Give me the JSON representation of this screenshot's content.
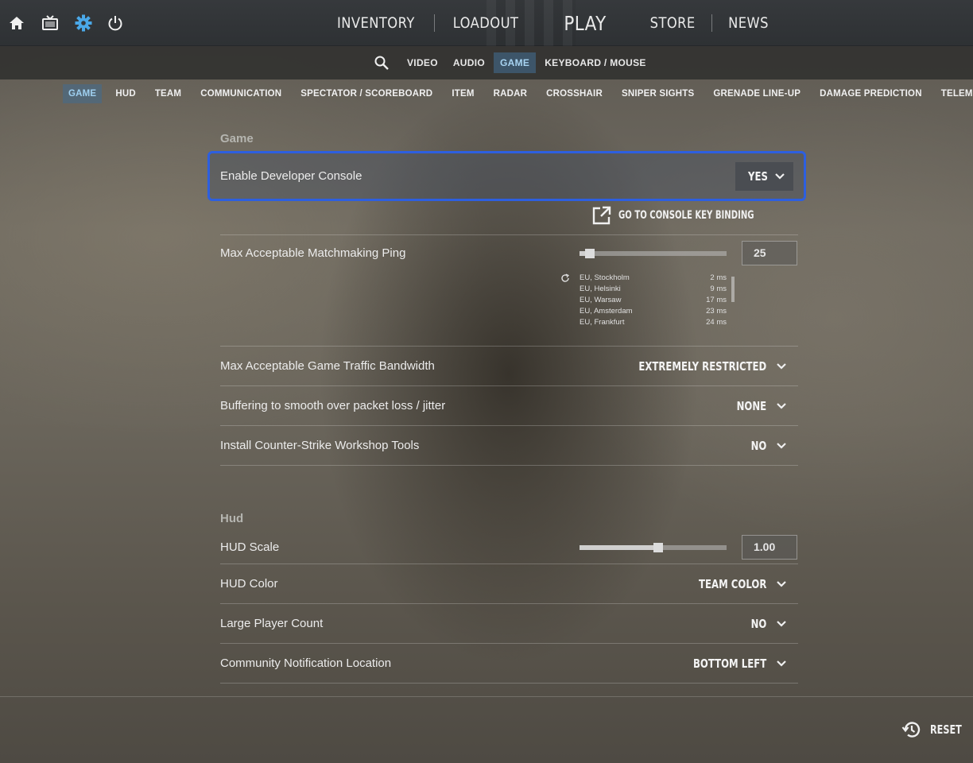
{
  "colors": {
    "focus_border": "#2d5fe0",
    "active_tab_text": "#a8d4f2",
    "settings_icon": "#4aa8e8"
  },
  "topbar": {
    "icons": [
      "home-icon",
      "tv-icon",
      "settings-gear-icon",
      "power-icon"
    ],
    "nav": {
      "inventory": "INVENTORY",
      "loadout": "LOADOUT",
      "play": "PLAY",
      "store": "STORE",
      "news": "NEWS"
    }
  },
  "subnav": {
    "search_icon": "search-icon",
    "items": {
      "video": "VIDEO",
      "audio": "AUDIO",
      "game": "GAME",
      "keyboard": "KEYBOARD / MOUSE"
    },
    "active": "GAME"
  },
  "categories": {
    "game": "GAME",
    "hud": "HUD",
    "team": "TEAM",
    "communication": "COMMUNICATION",
    "spectator": "SPECTATOR / SCOREBOARD",
    "item": "ITEM",
    "radar": "RADAR",
    "crosshair": "CROSSHAIR",
    "sniper": "SNIPER SIGHTS",
    "grenade": "GRENADE LINE-UP",
    "damage": "DAMAGE PREDICTION",
    "telemetry": "TELEMETRY",
    "active": "GAME"
  },
  "game_section": {
    "title": "Game",
    "dev_console": {
      "label": "Enable Developer Console",
      "value": "YES"
    },
    "console_link": "GO TO CONSOLE KEY BINDING",
    "ping": {
      "label": "Max Acceptable Matchmaking Ping",
      "value": "25",
      "slider_fraction": 0.04,
      "servers": [
        {
          "name": "EU, Stockholm",
          "ms": "2 ms"
        },
        {
          "name": "EU, Helsinki",
          "ms": "9 ms"
        },
        {
          "name": "EU, Warsaw",
          "ms": "17 ms"
        },
        {
          "name": "EU, Amsterdam",
          "ms": "23 ms"
        },
        {
          "name": "EU, Frankfurt",
          "ms": "24 ms"
        }
      ]
    },
    "bandwidth": {
      "label": "Max Acceptable Game Traffic Bandwidth",
      "value": "EXTREMELY RESTRICTED"
    },
    "buffering": {
      "label": "Buffering to smooth over packet loss / jitter",
      "value": "NONE"
    },
    "workshop": {
      "label": "Install Counter-Strike Workshop Tools",
      "value": "NO"
    }
  },
  "hud_section": {
    "title": "Hud",
    "scale": {
      "label": "HUD Scale",
      "value": "1.00",
      "slider_fraction": 0.5
    },
    "color": {
      "label": "HUD Color",
      "value": "TEAM COLOR"
    },
    "player_count": {
      "label": "Large Player Count",
      "value": "NO"
    },
    "notification": {
      "label": "Community Notification Location",
      "value": "BOTTOM LEFT"
    }
  },
  "footer": {
    "reset": "RESET"
  }
}
